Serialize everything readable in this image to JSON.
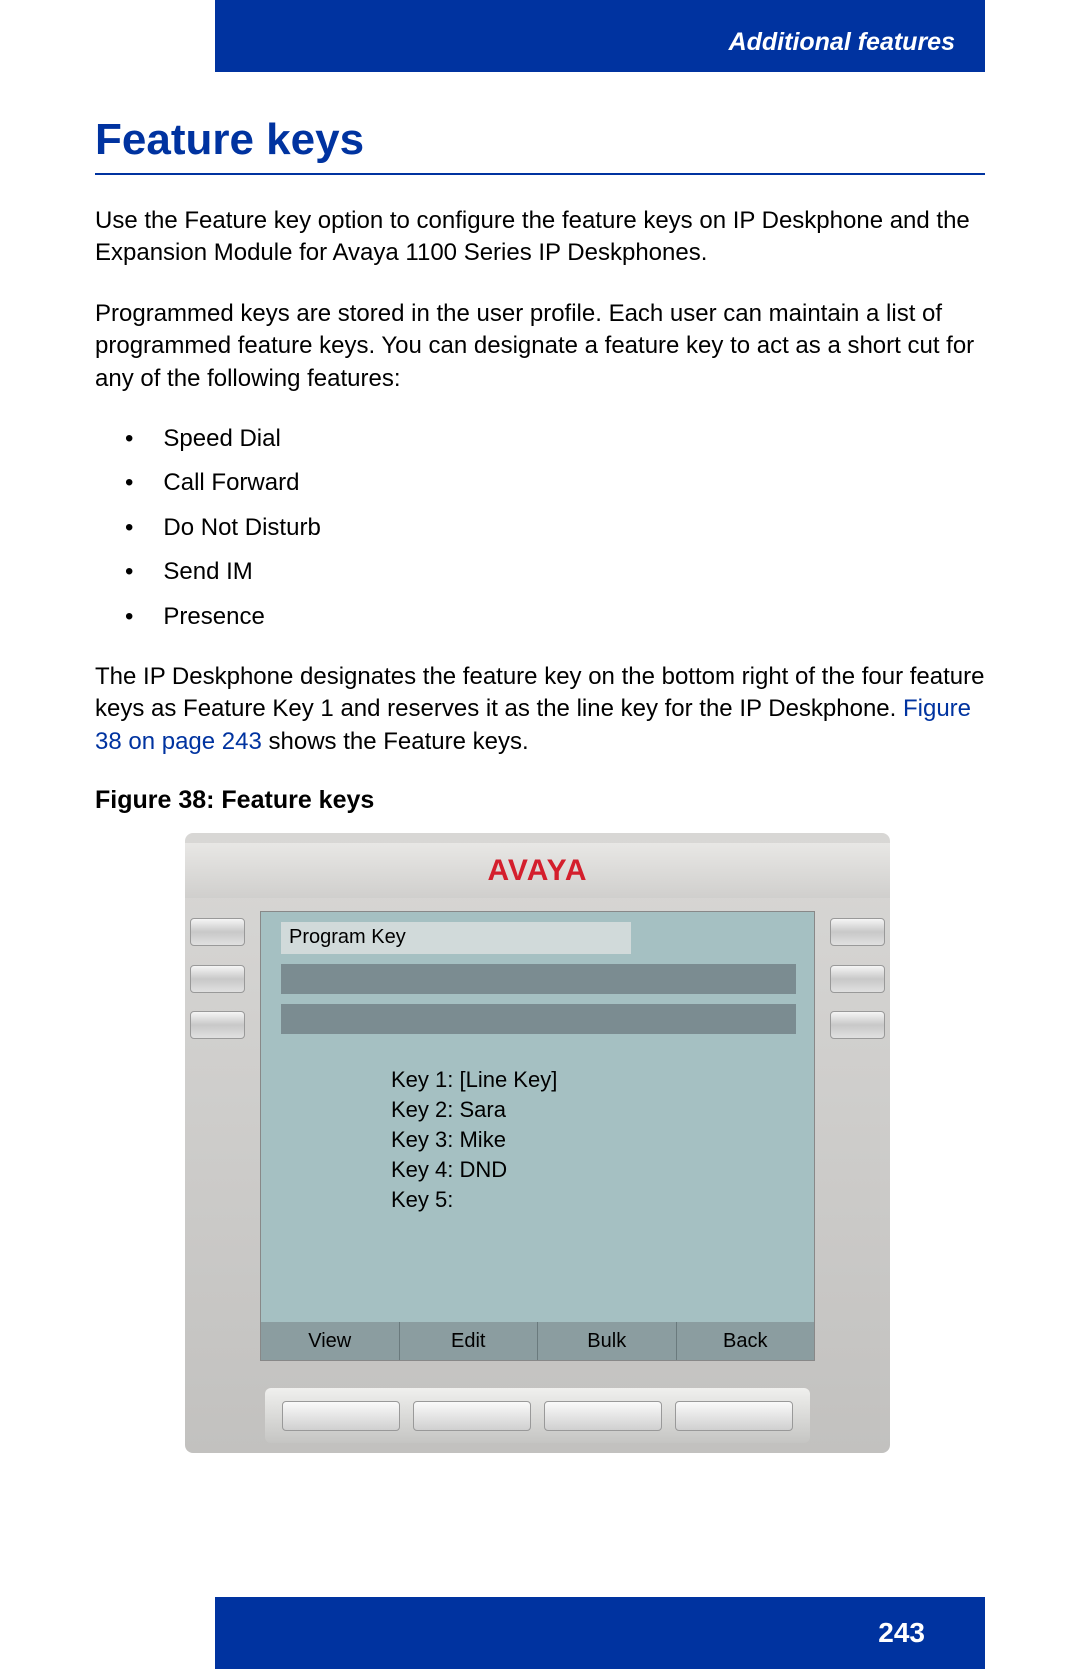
{
  "header": {
    "section": "Additional features"
  },
  "title": "Feature keys",
  "paragraph1": "Use the Feature key option to configure the feature keys on IP Deskphone and the Expansion Module for Avaya 1100 Series IP Deskphones.",
  "paragraph2": "Programmed keys are stored in the user profile. Each user can maintain a list of programmed feature keys. You can designate a feature key to act as a short cut for any of the following features:",
  "bullets": [
    "Speed Dial",
    "Call Forward",
    "Do Not Disturb",
    "Send IM",
    "Presence"
  ],
  "paragraph3_pre": "The IP Deskphone designates the feature key on the bottom right of the four feature keys as Feature Key 1 and reserves it as the line key for the IP Deskphone. ",
  "paragraph3_link": "Figure 38 on page 243",
  "paragraph3_post": " shows the Feature keys.",
  "figure_caption": "Figure 38: Feature keys",
  "phone": {
    "logo": "AVAYA",
    "screen_title": "Program Key",
    "keys": [
      "Key 1: [Line Key]",
      "Key 2: Sara",
      "Key 3: Mike",
      "Key 4: DND",
      "Key 5:"
    ],
    "softkeys": [
      "View",
      "Edit",
      "Bulk",
      "Back"
    ]
  },
  "page_number": "243"
}
